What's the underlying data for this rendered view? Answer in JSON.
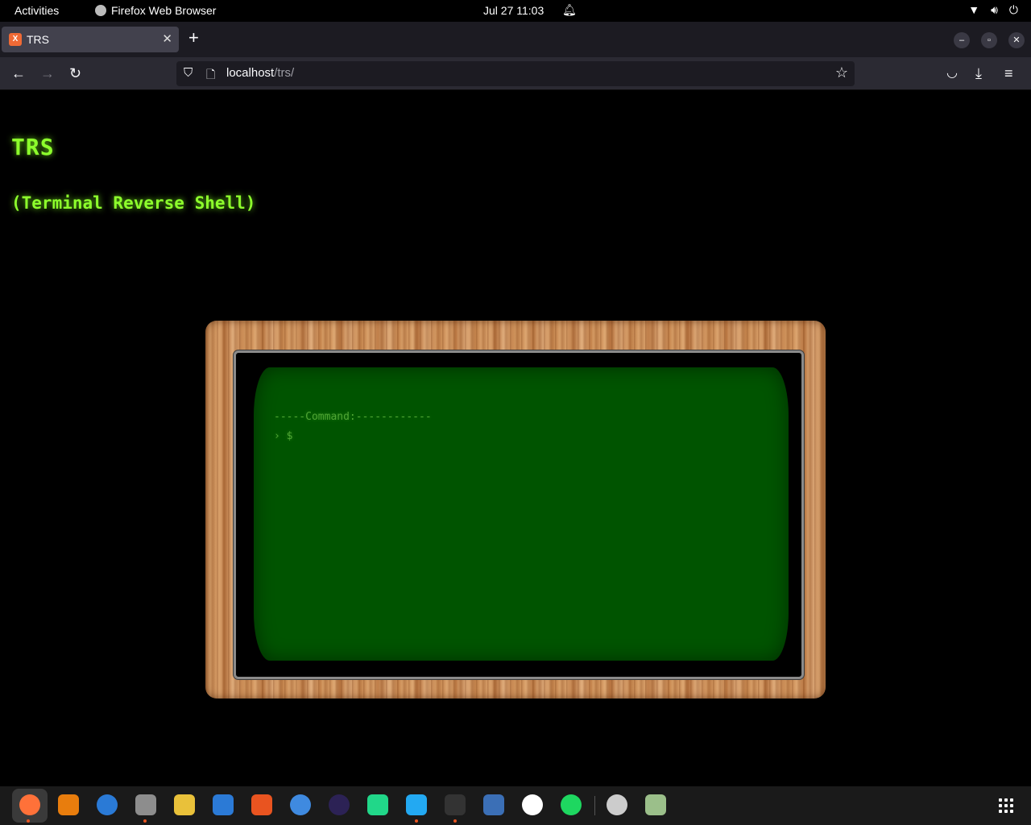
{
  "system_bar": {
    "activities": "Activities",
    "app_name": "Firefox Web Browser",
    "datetime": "Jul 27  11:03"
  },
  "browser": {
    "tab": {
      "title": "TRS",
      "favicon": "xampp-icon"
    },
    "url": {
      "host": "localhost",
      "path": "/trs/"
    }
  },
  "page": {
    "title": "TRS",
    "subtitle": "(Terminal Reverse Shell)",
    "terminal": {
      "command_header": "-----Command:------------",
      "prompt": "› $"
    }
  },
  "dock": {
    "items": [
      {
        "name": "firefox-icon",
        "color": "#ff7139"
      },
      {
        "name": "blender-icon",
        "color": "#e87d0d"
      },
      {
        "name": "thunderbird-icon",
        "color": "#2a7ad6"
      },
      {
        "name": "files-icon",
        "color": "#8d8d8d"
      },
      {
        "name": "rhythmbox-icon",
        "color": "#e9c13a"
      },
      {
        "name": "writer-icon",
        "color": "#2b7ad6"
      },
      {
        "name": "software-icon",
        "color": "#e95420"
      },
      {
        "name": "help-icon",
        "color": "#3f8ae0"
      },
      {
        "name": "eclipse-icon",
        "color": "#2c2255"
      },
      {
        "name": "pycharm-icon",
        "color": "#21d789"
      },
      {
        "name": "vscode-icon",
        "color": "#23a9f2"
      },
      {
        "name": "terminal-icon",
        "color": "#333333"
      },
      {
        "name": "remmina-icon",
        "color": "#3b6fb6"
      },
      {
        "name": "webstorm-icon",
        "color": "#ffffff"
      },
      {
        "name": "spotify-icon",
        "color": "#1ed760"
      },
      {
        "name": "dvd-icon",
        "color": "#cccccc"
      },
      {
        "name": "trash-icon",
        "color": "#9bbf8a"
      }
    ]
  }
}
